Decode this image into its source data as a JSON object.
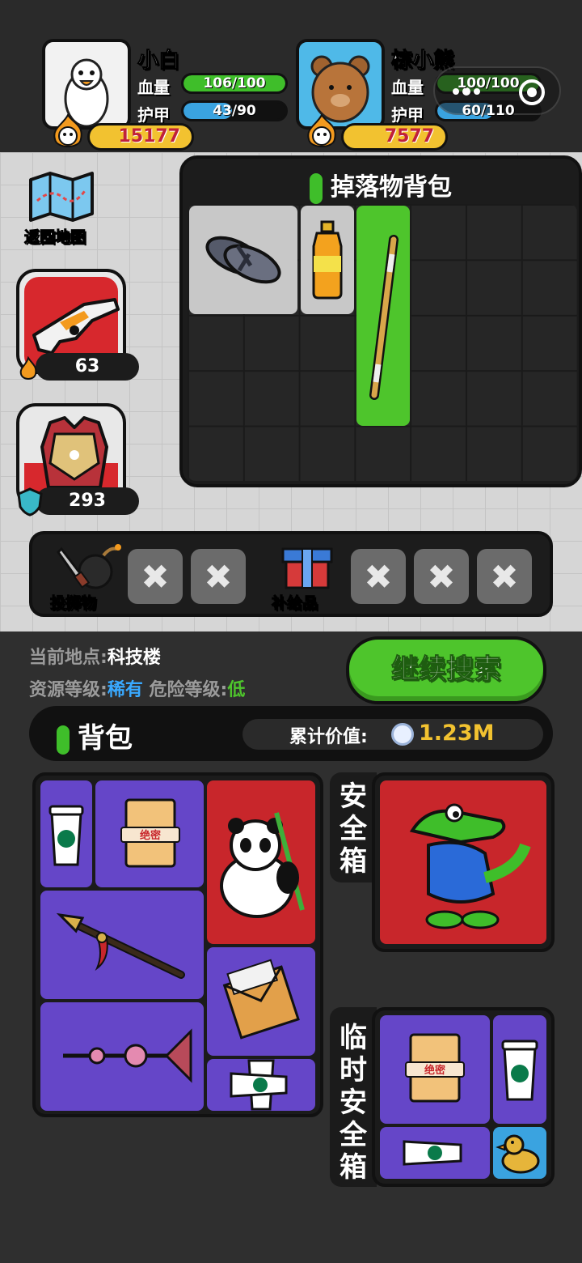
{
  "players": [
    {
      "name": "小白",
      "hp_label": "血量",
      "hp_text": "106/100",
      "hp_fraction": 1.0,
      "armor_label": "护甲",
      "armor_text": "43/90",
      "armor_fraction": 0.48,
      "score": "15177",
      "avatar": "white-goose-avatar"
    },
    {
      "name": "棕小熊",
      "hp_label": "血量",
      "hp_text": "100/100",
      "hp_fraction": 1.0,
      "armor_label": "护甲",
      "armor_text": "60/110",
      "armor_fraction": 0.55,
      "score": "7577",
      "avatar": "brown-bear-avatar"
    }
  ],
  "capsule": {
    "more_icon": "more-dots-icon",
    "close_icon": "target-close-icon"
  },
  "sidebar": {
    "map_label": "返回地图",
    "weapon_value": "63",
    "armor_value": "293"
  },
  "loot": {
    "title": "掉落物背包",
    "items": [
      "flip-flops",
      "orange-soda-bottle",
      "wooden-staff"
    ]
  },
  "quick_slots": {
    "throwable_label": "投掷物",
    "supply_label": "补给品",
    "empty_mark": "✖"
  },
  "location": {
    "current_label": "当前地点:",
    "current_value": "科技楼",
    "resource_label": "资源等级:",
    "resource_value": "稀有",
    "danger_label": "危险等级:",
    "danger_value": "低"
  },
  "continue_button": "继续搜索",
  "backpack": {
    "title": "背包",
    "value_label": "累计价值:",
    "value": "1.23M"
  },
  "safe_box": {
    "label": "安全箱"
  },
  "temp_safe_box": {
    "label": "临时安全箱"
  },
  "colors": {
    "green": "#4ec52c",
    "blue_text": "#39a9ff",
    "gold": "#f2c230",
    "purple": "#6546c8",
    "red": "#c8262b"
  }
}
